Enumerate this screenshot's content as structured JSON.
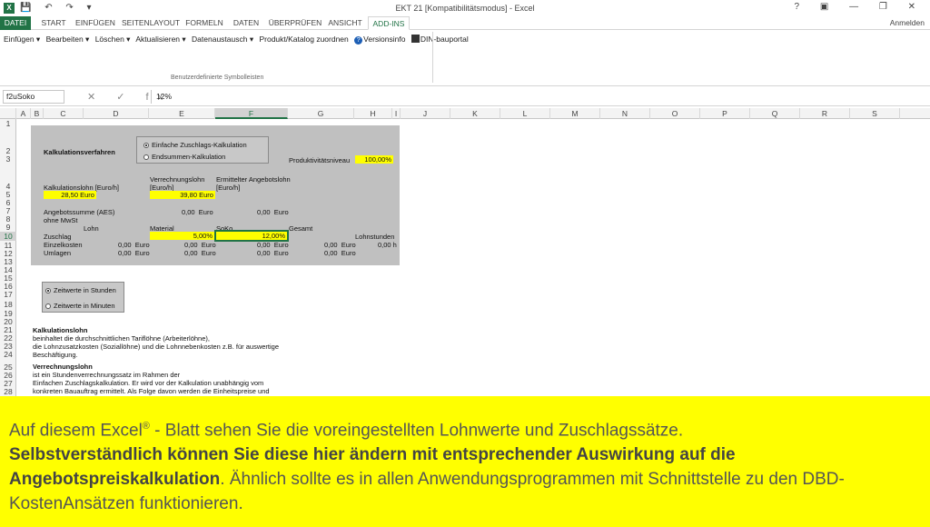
{
  "titlebar": {
    "app_logo": "X",
    "qat": "💾 ↶ ↷ ▾",
    "title": "EKT 21  [Kompatibilitätsmodus] - Excel",
    "window_buttons": "? ▣ — ❐ ✕"
  },
  "tabs": {
    "file": "DATEI",
    "items": [
      "START",
      "EINFÜGEN",
      "SEITENLAYOUT",
      "FORMELN",
      "DATEN",
      "ÜBERPRÜFEN",
      "ANSICHT",
      "ADD-INS"
    ],
    "signin": "Anmelden"
  },
  "ribbon": {
    "commands": [
      "Einfügen ▾",
      "Bearbeiten ▾",
      "Löschen ▾",
      "Aktualisieren ▾",
      "Datenaustausch ▾",
      "Produkt/Katalog zuordnen",
      "Versionsinfo",
      "DIN-bauportal"
    ],
    "group_label": "Benutzerdefinierte Symbolleisten"
  },
  "formula_bar": {
    "name_box": "f2uSoko",
    "icons": "✕ ✓ fx",
    "value": "12%"
  },
  "columns": [
    "A",
    "B",
    "C",
    "D",
    "E",
    "F",
    "G",
    "H",
    "I",
    "J",
    "K",
    "L",
    "M",
    "N",
    "O",
    "P",
    "Q",
    "R",
    "S"
  ],
  "rows": [
    "1",
    "2",
    "3",
    "4",
    "5",
    "6",
    "7",
    "8",
    "9",
    "10",
    "11",
    "12",
    "13",
    "14",
    "15",
    "16",
    "17",
    "18",
    "19",
    "20",
    "21",
    "22",
    "23",
    "24",
    "25",
    "26",
    "27",
    "28"
  ],
  "form": {
    "heading": "Kalkulationsverfahren",
    "radio1": "Einfache Zuschlags-Kalkulation",
    "radio2": "Endsummen-Kalkulation",
    "produktivitaet_label": "Produktivitätsniveau",
    "produktivitaet_value": "100,00%",
    "verrechnungslohn_label1": "Verrechnungslohn",
    "verrechnungslohn_label2": "[Euro/h]",
    "ermittelt_label1": "Ermittelter Angebotslohn",
    "ermittelt_label2": "[Euro/h]",
    "kalklohn_label": "Kalkulationslohn [Euro/h]",
    "kalklohn_value": "28,50",
    "kalklohn_unit": "Euro",
    "verrechnung_value": "39,80",
    "verrechnung_unit": "Euro",
    "aes_label": "Angebotssumme (AES)",
    "aes_sub": "ohne MwSt",
    "aes_value": "0,00",
    "aes_unit": "Euro",
    "aes_value2": "0,00",
    "aes_unit2": "Euro",
    "hdr_lohn": "Lohn",
    "hdr_material": "Material",
    "hdr_soko": "SoKo",
    "hdr_gesamt": "Gesamt",
    "hdr_lohnstunden": "Lohnstunden",
    "zuschlag_label": "Zuschlag",
    "zuschlag_material": "5,00%",
    "zuschlag_soko": "12,00%",
    "einzelkosten_label": "Einzelkosten",
    "umlagen_label": "Umlagen",
    "zero": "0,00",
    "euro": "Euro",
    "hours": "0,00 h"
  },
  "zeitwerte": {
    "radio1": "Zeitwerte in Stunden",
    "radio2": "Zeitwerte in Minuten"
  },
  "notes": {
    "kalk_title": "Kalkulationslohn",
    "kalk_l1": "beinhaltet die durchschnittlichen Tariflöhne (Arbeiterlöhne),",
    "kalk_l2": "die Lohnzusatzkosten (Soziallöhne) und die Lohnnebenkosten z.B. für auswertige",
    "kalk_l3": "Beschäftigung.",
    "verr_title": "Verrechnungslohn",
    "verr_l1": "ist ein Stundenverrechnungssatz im Rahmen der",
    "verr_l2": "Einfachen Zuschlagskalkulation. Er wird vor der Kalkulation unabhängig vom",
    "verr_l3": "konkreten Bauauftrag ermittelt. Als Folge davon werden die Einheitspreise und"
  },
  "overlay": {
    "line1": "Auf diesem Excel",
    "reg": "®",
    "line1b": " - Blatt sehen Sie die voreingestellten Lohnwerte und Zuschlagssätze.",
    "bold": "Selbstverständlich können Sie diese hier ändern mit entsprechender Auswirkung auf die Angebotspreiskalkulation",
    "rest": ". Ähnlich sollte es in allen Anwendungsprogrammen mit Schnittstelle zu den DBD-KostenAnsätzen funktionieren."
  }
}
